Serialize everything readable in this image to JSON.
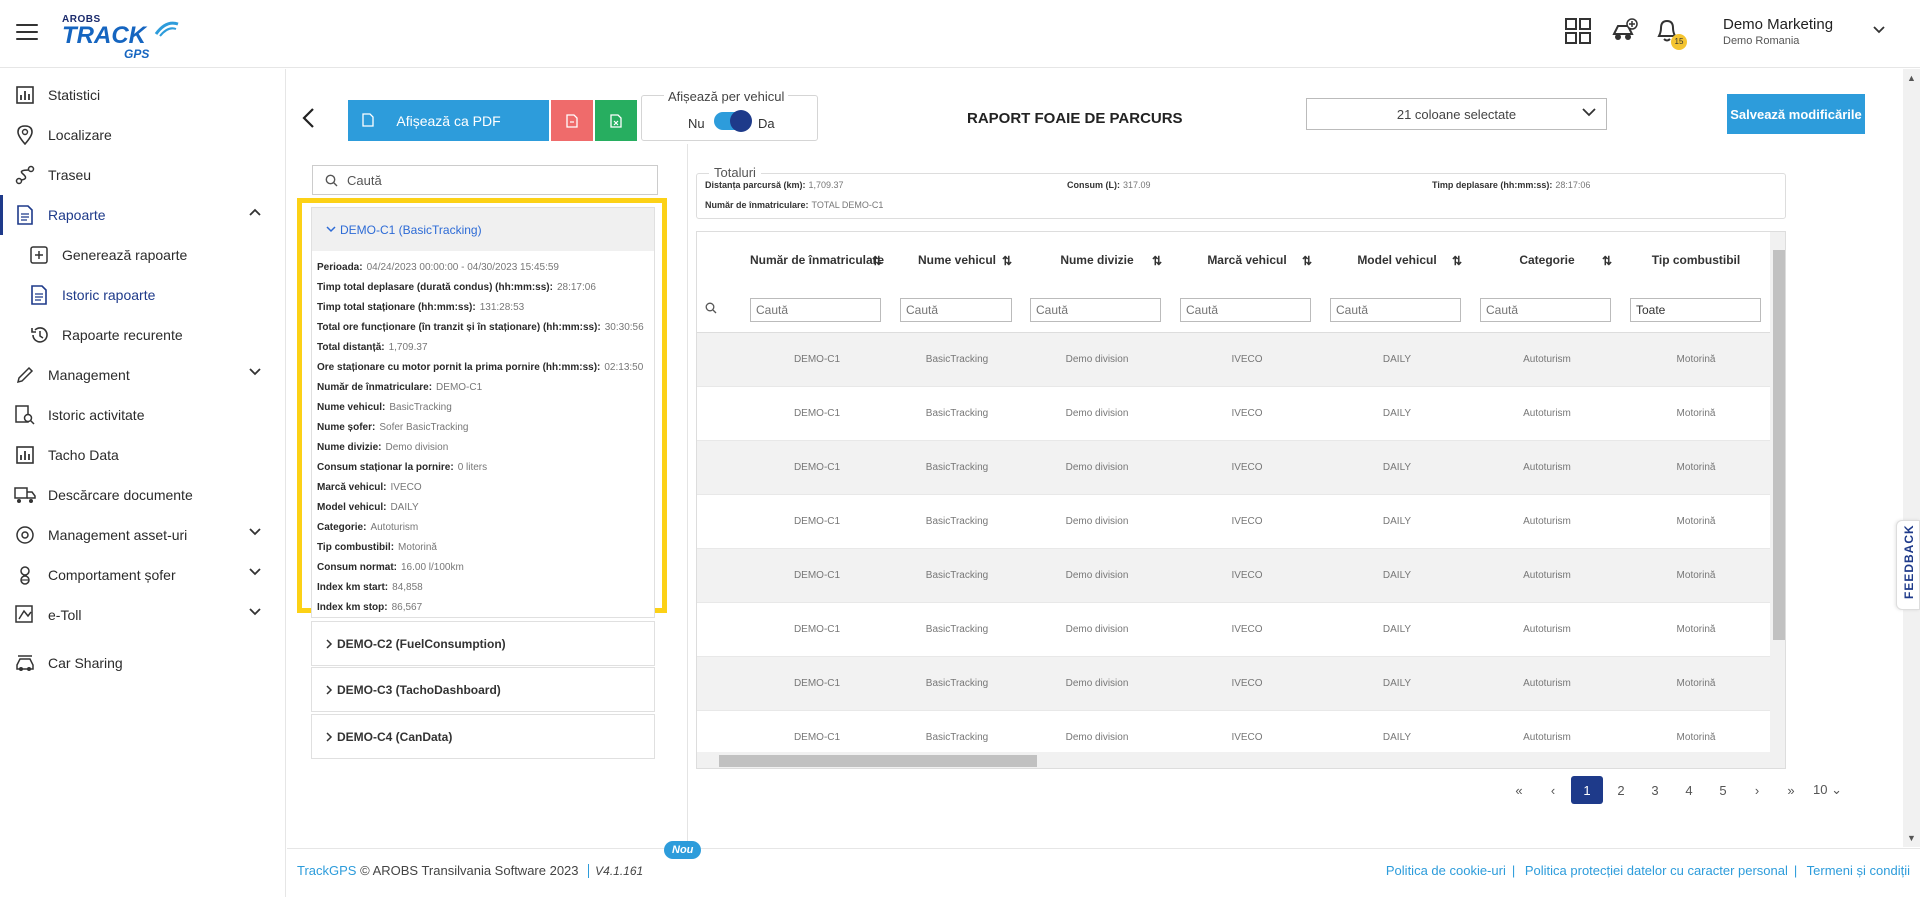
{
  "header": {
    "logo": {
      "top": "AROBS",
      "main": "TRACK",
      "sub": "GPS"
    },
    "user_name": "Demo Marketing",
    "user_company": "Demo Romania",
    "notification_count": "15"
  },
  "sidebar": {
    "items": [
      {
        "label": "Statistici"
      },
      {
        "label": "Localizare"
      },
      {
        "label": "Traseu"
      },
      {
        "label": "Rapoarte"
      },
      {
        "label": "Generează rapoarte"
      },
      {
        "label": "Istoric rapoarte"
      },
      {
        "label": "Rapoarte recurente"
      },
      {
        "label": "Management"
      },
      {
        "label": "Istoric activitate"
      },
      {
        "label": "Tacho Data"
      },
      {
        "label": "Descărcare documente"
      },
      {
        "label": "Management asset-uri"
      },
      {
        "label": "Comportament șofer"
      },
      {
        "label": "e-Toll"
      },
      {
        "label": "Car Sharing"
      }
    ]
  },
  "toolbar": {
    "pdf_label": "Afișează ca PDF",
    "per_vehicle_title": "Afișează per vehicul",
    "no_label": "Nu",
    "yes_label": "Da",
    "report_title": "RAPORT FOAIE DE PARCURS",
    "columns_selected": "21 coloane selectate",
    "save_label": "Salvează modificările"
  },
  "search": {
    "placeholder": "Caută"
  },
  "groups": [
    {
      "title": "DEMO-C1 (BasicTracking)"
    },
    {
      "title": "DEMO-C2 (FuelConsumption)"
    },
    {
      "title": "DEMO-C3 (TachoDashboard)"
    },
    {
      "title": "DEMO-C4 (CanData)"
    }
  ],
  "details": [
    {
      "k": "Perioada:",
      "v": "04/24/2023 00:00:00 - 04/30/2023 15:45:59"
    },
    {
      "k": "Timp total deplasare (durată condus) (hh:mm:ss):",
      "v": "28:17:06"
    },
    {
      "k": "Timp total staționare (hh:mm:ss):",
      "v": "131:28:53"
    },
    {
      "k": "Total ore funcționare (în tranzit și în staționare) (hh:mm:ss):",
      "v": "30:30:56"
    },
    {
      "k": "Total distanță:",
      "v": "1,709.37"
    },
    {
      "k": "Ore staționare cu motor pornit la prima pornire (hh:mm:ss):",
      "v": "02:13:50"
    },
    {
      "k": "Număr de înmatriculare:",
      "v": "DEMO-C1"
    },
    {
      "k": "Nume vehicul:",
      "v": "BasicTracking"
    },
    {
      "k": "Nume șofer:",
      "v": "Sofer BasicTracking"
    },
    {
      "k": "Nume divizie:",
      "v": "Demo division"
    },
    {
      "k": "Consum staționar la pornire:",
      "v": "0 liters"
    },
    {
      "k": "Marcă vehicul:",
      "v": "IVECO"
    },
    {
      "k": "Model vehicul:",
      "v": "DAILY"
    },
    {
      "k": "Categorie:",
      "v": "Autoturism"
    },
    {
      "k": "Tip combustibil:",
      "v": "Motorină"
    },
    {
      "k": "Consum normat:",
      "v": "16.00 l/100km"
    },
    {
      "k": "Index km start:",
      "v": "84,858"
    },
    {
      "k": "Index km stop:",
      "v": "86,567"
    }
  ],
  "totals": {
    "title": "Totaluri",
    "distance_k": "Distanța parcursă (km):",
    "distance_v": "1,709.37",
    "consum_k": "Consum (L):",
    "consum_v": "317.09",
    "time_k": "Timp deplasare (hh:mm:ss):",
    "time_v": "28:17:06",
    "plate_k": "Număr de înmatriculare:",
    "plate_v": "TOTAL DEMO-C1"
  },
  "table": {
    "columns": [
      "Număr de înmatriculare",
      "Nume vehicul",
      "Nume divizie",
      "Marcă vehicul",
      "Model vehicul",
      "Categorie",
      "Tip combustibil"
    ],
    "filter_placeholder": "Caută",
    "filter_select": "Toate",
    "rows": [
      [
        "DEMO-C1",
        "BasicTracking",
        "Demo division",
        "IVECO",
        "DAILY",
        "Autoturism",
        "Motorină"
      ],
      [
        "DEMO-C1",
        "BasicTracking",
        "Demo division",
        "IVECO",
        "DAILY",
        "Autoturism",
        "Motorină"
      ],
      [
        "DEMO-C1",
        "BasicTracking",
        "Demo division",
        "IVECO",
        "DAILY",
        "Autoturism",
        "Motorină"
      ],
      [
        "DEMO-C1",
        "BasicTracking",
        "Demo division",
        "IVECO",
        "DAILY",
        "Autoturism",
        "Motorină"
      ],
      [
        "DEMO-C1",
        "BasicTracking",
        "Demo division",
        "IVECO",
        "DAILY",
        "Autoturism",
        "Motorină"
      ],
      [
        "DEMO-C1",
        "BasicTracking",
        "Demo division",
        "IVECO",
        "DAILY",
        "Autoturism",
        "Motorină"
      ],
      [
        "DEMO-C1",
        "BasicTracking",
        "Demo division",
        "IVECO",
        "DAILY",
        "Autoturism",
        "Motorină"
      ],
      [
        "DEMO-C1",
        "BasicTracking",
        "Demo division",
        "IVECO",
        "DAILY",
        "Autoturism",
        "Motorină"
      ]
    ]
  },
  "pagination": {
    "pages": [
      "1",
      "2",
      "3",
      "4",
      "5"
    ],
    "active": "1",
    "page_size": "10"
  },
  "footer": {
    "brand": "TrackGPS",
    "copyright": "© AROBS Transilvania Software 2023",
    "version": "V4.1.161",
    "new_badge": "Nou",
    "links": [
      "Politica de cookie-uri",
      "Politica protecției datelor cu caracter personal",
      "Termeni și condiții"
    ]
  },
  "feedback_label": "FEEDBACK",
  "colors": {
    "accent": "#2d9cdb",
    "navy": "#1e3a8a",
    "highlight": "#fcd116",
    "red": "#ef6b6b",
    "green": "#27ae60"
  }
}
